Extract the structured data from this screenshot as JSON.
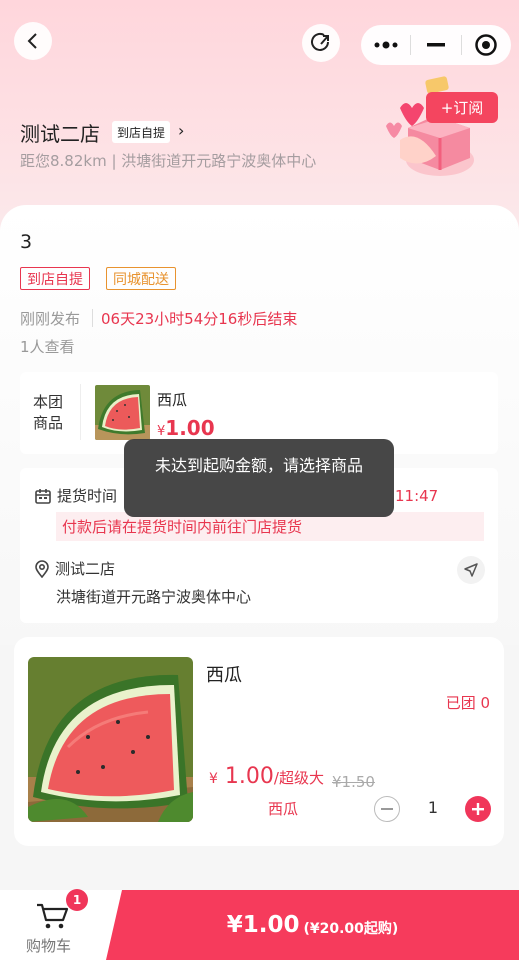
{
  "header": {
    "store_name": "测试二店",
    "pickup_tag": "到店自提",
    "tag_arrow": "›",
    "distance_address": "距您8.82km | 洪塘街道开元路宁波奥体中心",
    "subscribe_label": "+订阅"
  },
  "group": {
    "name": "3",
    "tags": [
      "到店自提",
      "同城配送"
    ],
    "published": "刚刚发布",
    "countdown": "06天23小时54分16秒后结束",
    "views": "1人查看"
  },
  "product_summary": {
    "label": "本团商品",
    "name": "西瓜",
    "currency": "¥",
    "price": "1.00"
  },
  "pickup": {
    "label": "提货时间",
    "time_visible": "11:47",
    "hint": "付款后请在提货时间内前往门店提货",
    "store_name": "测试二店",
    "address": "洪塘街道开元路宁波奥体中心"
  },
  "toast": {
    "message": "未达到起购金额，请选择商品"
  },
  "item": {
    "name": "西瓜",
    "sold": "已团 0",
    "currency": "¥",
    "price": "1.00",
    "unit": "/超级大",
    "original_price": "¥1.50",
    "subtitle": "西瓜",
    "quantity": "1"
  },
  "bottom_bar": {
    "cart_label": "购物车",
    "cart_badge": "1",
    "total": "¥1.00",
    "min_note": "(¥20.00起购)"
  },
  "colors": {
    "accent": "#f63b5c",
    "tag_red": "#e8364f",
    "tag_orange": "#e8932f"
  },
  "icons": [
    "back-icon",
    "share-icon",
    "more-icon",
    "minimize-icon",
    "close-target-icon",
    "calendar-icon",
    "location-pin-icon",
    "navigate-icon",
    "cart-icon",
    "minus-icon",
    "plus-icon"
  ]
}
